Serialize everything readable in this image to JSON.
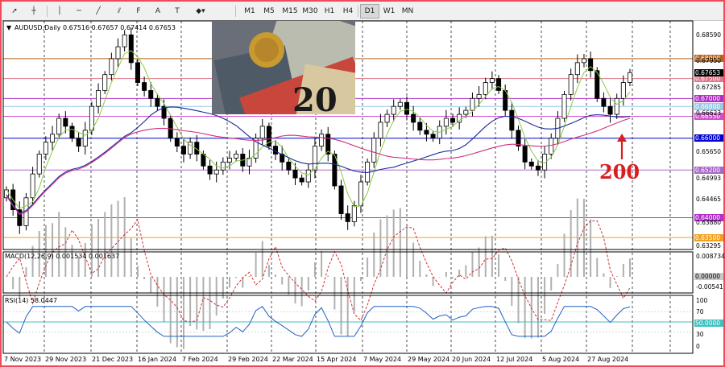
{
  "toolbar": {
    "tools": [
      {
        "name": "cursor-icon",
        "glyph": "➚"
      },
      {
        "name": "crosshair-icon",
        "glyph": "┼"
      },
      {
        "name": "vertical-line-icon",
        "glyph": "│"
      },
      {
        "name": "horizontal-line-icon",
        "glyph": "─"
      },
      {
        "name": "trendline-icon",
        "glyph": "╱"
      },
      {
        "name": "channel-icon",
        "glyph": "⫽"
      },
      {
        "name": "fibonacci-icon",
        "glyph": "F"
      },
      {
        "name": "text-icon",
        "glyph": "A"
      },
      {
        "name": "label-icon",
        "glyph": "T"
      },
      {
        "name": "shapes-icon",
        "glyph": "◆▾"
      }
    ],
    "timeframes": [
      "M1",
      "M5",
      "M15",
      "M30",
      "H1",
      "H4",
      "D1",
      "W1",
      "MN"
    ],
    "active_timeframe": "D1"
  },
  "chart_header": {
    "symbol": "AUDUSD,Daily",
    "ohlc": "0.67516 0.67657 0.67414 0.67653"
  },
  "price_axis": {
    "ticks": [
      "0.68590",
      "0.67950",
      "0.67285",
      "0.66623",
      "0.65650",
      "0.64993",
      "0.64465",
      "0.63880",
      "0.63295"
    ]
  },
  "levels": [
    {
      "value": "0.68000",
      "color": "#b5651d"
    },
    {
      "value": "0.67500",
      "color": "#e07a8a"
    },
    {
      "value": "0.67000",
      "color": "#b030c8"
    },
    {
      "value": "0.66800",
      "color": "#98c8e8"
    },
    {
      "value": "0.66550",
      "color": "#d050d0"
    },
    {
      "value": "0.66000",
      "color": "#0000d0"
    },
    {
      "value": "0.65200",
      "color": "#a86ac8"
    },
    {
      "value": "0.64000",
      "color": "#b030c8"
    },
    {
      "value": "0.63500",
      "color": "#f0a020"
    }
  ],
  "current_price": "0.67653",
  "macd": {
    "label": "MACD(12,26,9) 0.001534 0.001637",
    "ticks": [
      "0.008734",
      "0.00000",
      "-0.00541"
    ]
  },
  "rsi": {
    "label": "RSI(14) 58.0447",
    "ticks": [
      "100",
      "70",
      "50.0000",
      "30",
      "0"
    ]
  },
  "time_axis": {
    "ticks": [
      "7 Nov 2023",
      "29 Nov 2023",
      "21 Dec 2023",
      "16 Jan 2024",
      "7 Feb 2024",
      "29 Feb 2024",
      "22 Mar 2024",
      "15 Apr 2024",
      "7 May 2024",
      "29 May 2024",
      "20 Jun 2024",
      "12 Jul 2024",
      "5 Aug 2024",
      "27 Aug 2024"
    ]
  },
  "annotation": {
    "text": "200",
    "color": "#d91e1e"
  },
  "colors": {
    "candle": "#000000",
    "ma_fast": "#88cc44",
    "ma_mid": "#1a2a9a",
    "ma_slow": "#d0307a",
    "macd_signal": "#d03030",
    "rsi_line": "#2060c0",
    "rsi_level": "#40c0c0"
  },
  "chart_data": {
    "type": "candlestick",
    "series_close": [
      0.647,
      0.642,
      0.638,
      0.645,
      0.651,
      0.656,
      0.659,
      0.661,
      0.665,
      0.663,
      0.66,
      0.658,
      0.662,
      0.668,
      0.672,
      0.676,
      0.68,
      0.683,
      0.686,
      0.679,
      0.674,
      0.672,
      0.67,
      0.668,
      0.665,
      0.66,
      0.658,
      0.656,
      0.659,
      0.656,
      0.653,
      0.651,
      0.652,
      0.654,
      0.655,
      0.656,
      0.653,
      0.655,
      0.66,
      0.663,
      0.658,
      0.656,
      0.654,
      0.652,
      0.65,
      0.649,
      0.652,
      0.658,
      0.661,
      0.656,
      0.648,
      0.641,
      0.639,
      0.643,
      0.649,
      0.654,
      0.66,
      0.664,
      0.666,
      0.668,
      0.669,
      0.666,
      0.664,
      0.662,
      0.661,
      0.66,
      0.663,
      0.665,
      0.664,
      0.666,
      0.667,
      0.67,
      0.671,
      0.674,
      0.675,
      0.672,
      0.667,
      0.662,
      0.658,
      0.654,
      0.653,
      0.652,
      0.656,
      0.66,
      0.665,
      0.671,
      0.676,
      0.679,
      0.68,
      0.677,
      0.67,
      0.668,
      0.666,
      0.67,
      0.674,
      0.6765
    ]
  }
}
